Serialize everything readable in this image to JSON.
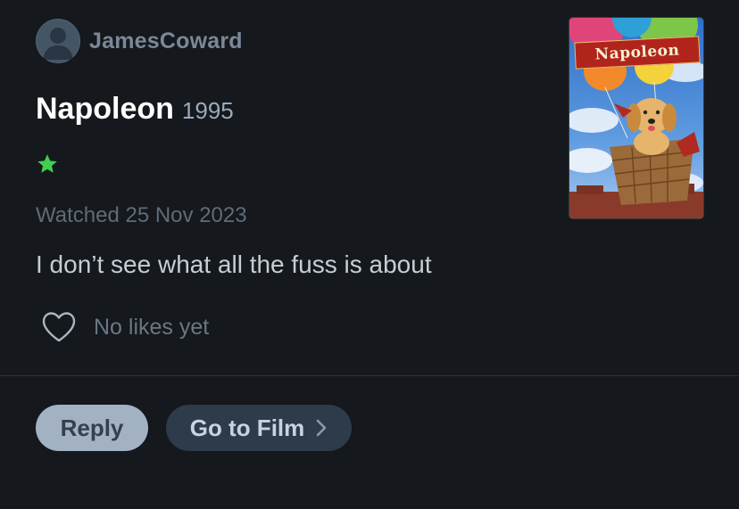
{
  "user": {
    "username": "JamesCoward",
    "avatar_icon": "user-silhouette-icon"
  },
  "film": {
    "title": "Napoleon",
    "year": "1995",
    "poster_title": "Napoleon"
  },
  "review": {
    "rating_stars": 1,
    "rating_icon": "star-icon",
    "star_color": "#40bcf4",
    "watched_text": "Watched 25 Nov 2023",
    "text": "I don’t see what all the fuss is about"
  },
  "likes": {
    "icon": "heart-icon",
    "text": "No likes yet"
  },
  "actions": {
    "reply_label": "Reply",
    "go_to_film_label": "Go to Film",
    "go_to_film_icon": "chevron-right-icon"
  },
  "colors": {
    "background": "#15181c",
    "star": "#40d050",
    "reply_button_bg": "#a3b2c3",
    "film_button_bg": "#2e3b4a"
  }
}
